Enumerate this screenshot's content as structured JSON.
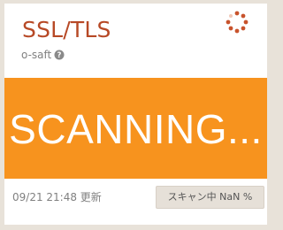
{
  "card": {
    "title": "SSL/TLS",
    "subtitle": "o-saft",
    "help_icon": "question-circle-icon",
    "spinner_icon": "loading-spinner-icon",
    "banner_text": "SCANNING...",
    "updated_text": "09/21 21:48 更新",
    "status_text": "スキャン中 NaN %"
  },
  "colors": {
    "title": "#b74926",
    "banner": "#f7931e",
    "spinner": "#c8532c",
    "background": "#e8e2d9"
  }
}
